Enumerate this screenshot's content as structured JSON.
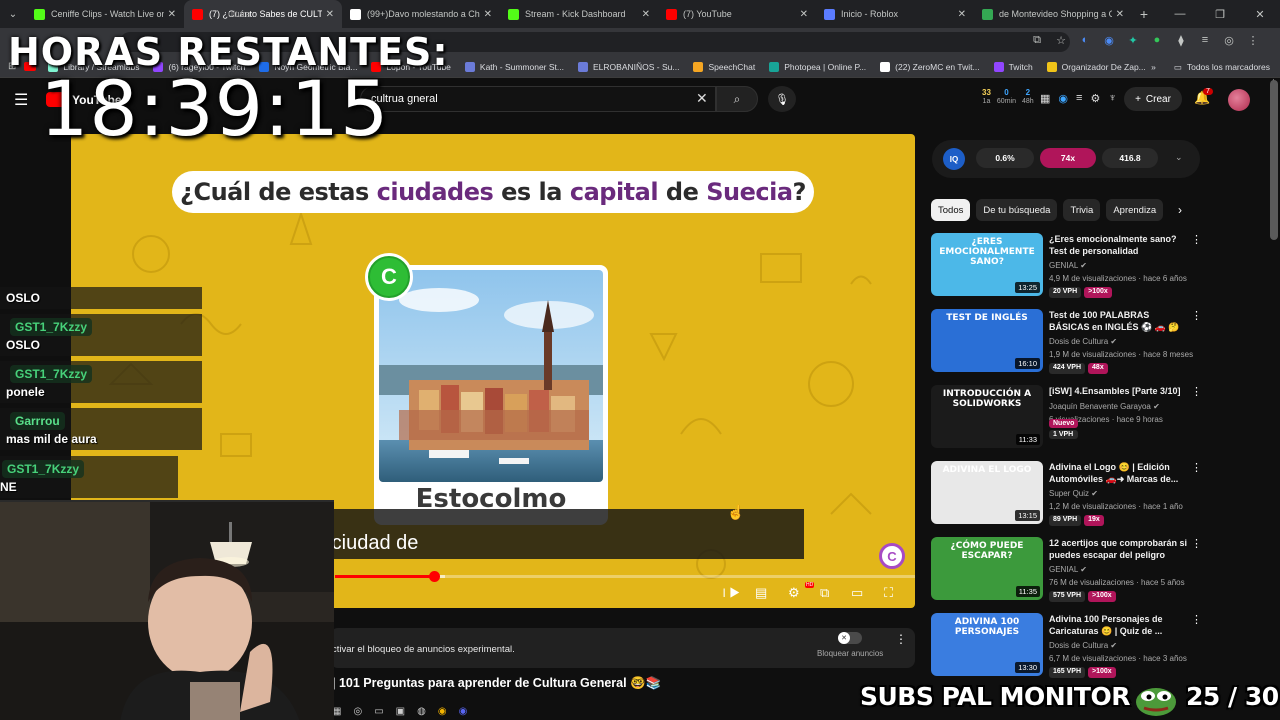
{
  "browser": {
    "tabs": [
      {
        "label": "Ceniffe Clips - Watch Live on Kick",
        "icon": "kick-icon",
        "color": "#53fc18"
      },
      {
        "label": "(7) ¿Cuánto Sabes de CULTURA GENERAL",
        "icon": "youtube-icon",
        "color": "#ff0000"
      },
      {
        "label": "(99+)Davo molestando a Chile",
        "icon": "tiktok-icon",
        "color": "#ffffff"
      },
      {
        "label": "Stream - Kick Dashboard",
        "icon": "kick-icon",
        "color": "#53fc18"
      },
      {
        "label": "(7) YouTube",
        "icon": "youtube-icon",
        "color": "#ff0000"
      },
      {
        "label": "Inicio - Roblox",
        "icon": "roblox-icon",
        "color": "#5b7cff"
      },
      {
        "label": "de Montevideo Shopping a Ciudad",
        "icon": "maps-icon",
        "color": "#34a853"
      }
    ],
    "address_text": "ultura",
    "bookmarks": [
      {
        "label": "Library / Streamlabs",
        "color": "#80f5d2"
      },
      {
        "label": "(6) rageylo0 - Twitch",
        "color": "#9146ff"
      },
      {
        "label": "Noyh Geometric Bla...",
        "color": "#1e6ce8"
      },
      {
        "label": "Lopon - YouTube",
        "color": "#ff0000"
      },
      {
        "label": "Kath - Summoner St...",
        "color": "#6b7bd8"
      },
      {
        "label": "ELROBANIÑOS - Su...",
        "color": "#6b7bd8"
      },
      {
        "label": "SpeechChat",
        "color": "#f5a623"
      },
      {
        "label": "Photopea | Online P...",
        "color": "#18a497"
      },
      {
        "label": "(22) ZeroMC en Twit...",
        "color": "#ffffff"
      },
      {
        "label": "Twitch",
        "color": "#9146ff"
      },
      {
        "label": "Organizador De Zap...",
        "color": "#f0c419"
      }
    ],
    "bookmarks_all": "Todos los marcadores"
  },
  "youtube": {
    "logo_text": "YouTube",
    "search_value": "cultrua gneral",
    "stats": [
      {
        "value": "33",
        "label": "1a"
      },
      {
        "value": "0",
        "label": "60min"
      },
      {
        "value": "2",
        "label": "48h"
      }
    ],
    "create_label": "Crear",
    "notif_count": "7"
  },
  "player": {
    "question_pre": "¿Cuál de estas ",
    "question_hl1": "ciudades",
    "question_mid": " es la ",
    "question_hl2": "capital",
    "question_de": " de ",
    "question_hl3": "Suecia",
    "question_end": "?",
    "answer_letter": "C",
    "answer_label": "Estocolmo",
    "subtitle": "a ciudad de",
    "channel_logo": "C",
    "progress_pct": 17,
    "buffer_pct": 19
  },
  "below": {
    "ad_text": "ctivar el bloqueo de anuncios experimental.",
    "ad_toggle_label": "Bloquear anuncios",
    "video_title": "| 101 Preguntas para aprender de Cultura General 🤓📚"
  },
  "sidebar": {
    "metrics": [
      "0.6%",
      "74x",
      "416.8"
    ],
    "iq_label": "IQ",
    "chips": [
      "Todos",
      "De tu búsqueda",
      "Trivia",
      "Aprendiza"
    ],
    "recs": [
      {
        "title": "¿Eres emocionalmente sano? Test de personalidad",
        "channel": "GENIAL",
        "meta": "4,9 M de visualizaciones · hace 6 años",
        "vph": "20 VPH",
        "mult": ">100x",
        "duration": "13:25",
        "thumb_text": "¿ERES EMOCIONALMENTE SANO?",
        "thumb_color": "#4cb8e8"
      },
      {
        "title": "Test de 100 PALABRAS BÁSICAS en INGLÉS ⚽ 🚗 🤔 ...",
        "channel": "Dosis de Cultura",
        "meta": "1,9 M de visualizaciones · hace 8 meses",
        "vph": "424 VPH",
        "mult": "48x",
        "duration": "16:10",
        "thumb_text": "TEST DE INGLÉS",
        "thumb_color": "#2a6fd6"
      },
      {
        "title": "[iSW] 4.Ensambles [Parte 3/10]",
        "channel": "Joaquín Benavente Garayoa",
        "meta": "6 visualizaciones · hace 9 horas",
        "vph": "1 VPH",
        "mult": "Nuevo",
        "duration": "11:33",
        "thumb_text": "INTRODUCCIÓN A SOLIDWORKS",
        "thumb_color": "#1b1b1b"
      },
      {
        "title": "Adivina el Logo 😊 | Edición Automóviles 🚗➜ Marcas de...",
        "channel": "Super Quiz",
        "meta": "1,2 M de visualizaciones · hace 1 año",
        "vph": "89 VPH",
        "mult": "19x",
        "duration": "13:15",
        "thumb_text": "ADIVINA EL LOGO",
        "thumb_color": "#e8e8e8"
      },
      {
        "title": "12 acertijos que comprobarán si puedes escapar del peligro",
        "channel": "GENIAL",
        "meta": "76 M de visualizaciones · hace 5 años",
        "vph": "575 VPH",
        "mult": ">100x",
        "duration": "11:35",
        "thumb_text": "¿CÓMO PUEDE ESCAPAR?",
        "thumb_color": "#3c9a3c"
      },
      {
        "title": "Adivina 100 Personajes de Caricaturas 😊 | Quiz de ...",
        "channel": "Dosis de Cultura",
        "meta": "6,7 M de visualizaciones · hace 3 años",
        "vph": "165 VPH",
        "mult": ">100x",
        "duration": "13:30",
        "thumb_text": "ADIVINA 100 PERSONAJES",
        "thumb_color": "#3a7de0"
      }
    ]
  },
  "stream": {
    "horas_label": "HORAS RESTANTES:",
    "timer": "18:39:15",
    "chat": [
      {
        "user": "",
        "msg": "OSLO"
      },
      {
        "user": "GST1_7Kzzy",
        "msg": "OSLO"
      },
      {
        "user": "GST1_7Kzzy",
        "msg": "ponele"
      },
      {
        "user": "Garrrou",
        "msg": "mas mil de aura"
      },
      {
        "user": "GST1_7Kzzy",
        "msg": "NE"
      }
    ],
    "subs_text": "SUBS PAL MONITOR",
    "subs_count": "25 / 30"
  }
}
